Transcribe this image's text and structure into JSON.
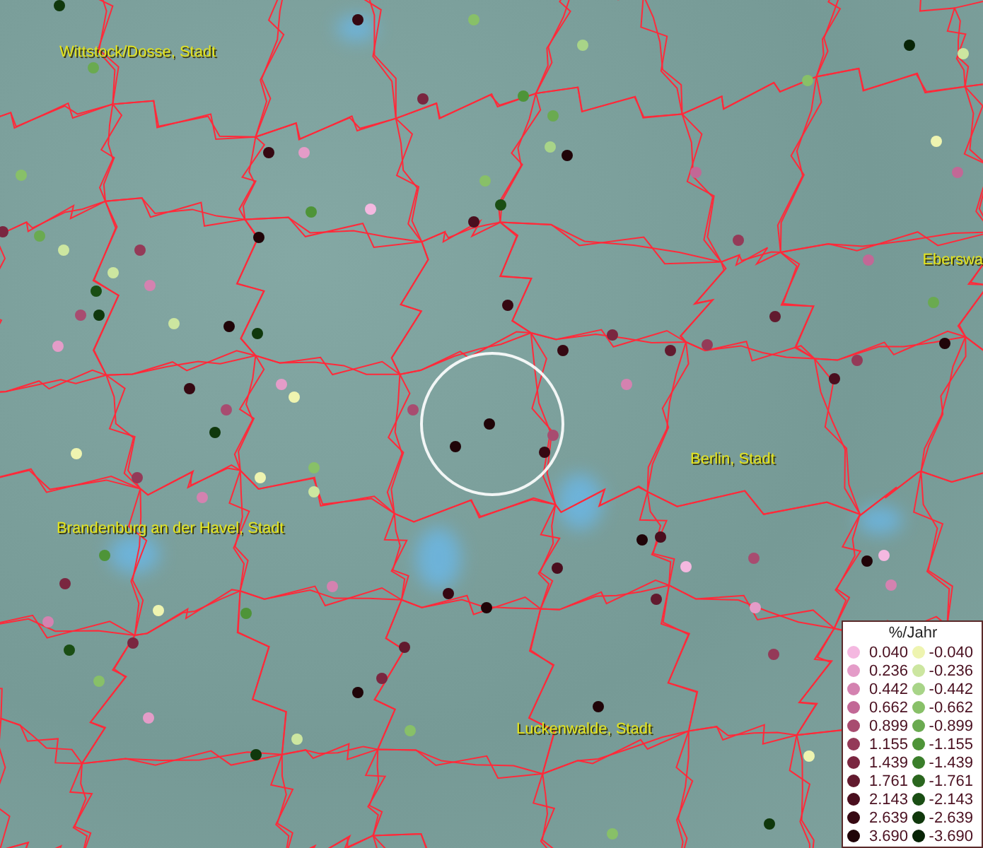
{
  "places": [
    {
      "name": "Wittstock/Dosse, Stadt"
    },
    {
      "name": "Eberswa"
    },
    {
      "name": "Berlin, Stadt"
    },
    {
      "name": "Brandenburg an der Havel, Stadt"
    },
    {
      "name": "Luckenwalde, Stadt"
    }
  ],
  "stations": [
    {
      "color": "#10380c"
    },
    {
      "color": "#360812"
    },
    {
      "color": "#88c068"
    },
    {
      "color": "#a8d488"
    },
    {
      "color": "#082406"
    },
    {
      "color": "#cce6a0"
    },
    {
      "color": "#88c068"
    },
    {
      "color": "#7a2640"
    },
    {
      "color": "#4e9438"
    },
    {
      "color": "#6aaa50"
    },
    {
      "color": "#6aaa50"
    },
    {
      "color": "#360812"
    },
    {
      "color": "#e49cc8"
    },
    {
      "color": "#a8d488"
    },
    {
      "color": "#200408"
    },
    {
      "color": "#88c068"
    },
    {
      "color": "#c26896"
    },
    {
      "color": "#c26896"
    },
    {
      "color": "#eef4b0"
    },
    {
      "color": "#88c068"
    },
    {
      "color": "#1a4e14"
    },
    {
      "color": "#4e9438"
    },
    {
      "color": "#f4b8e0"
    },
    {
      "color": "#4a0e1e"
    },
    {
      "color": "#200408"
    },
    {
      "color": "#7a2640"
    },
    {
      "color": "#6aaa50"
    },
    {
      "color": "#cce6a0"
    },
    {
      "color": "#943a58"
    },
    {
      "color": "#943a58"
    },
    {
      "color": "#c26896"
    },
    {
      "color": "#cce6a0"
    },
    {
      "color": "#d482b0"
    },
    {
      "color": "#1a4e14"
    },
    {
      "color": "#a84c70"
    },
    {
      "color": "#10380c"
    },
    {
      "color": "#6aaa50"
    },
    {
      "color": "#360812"
    },
    {
      "color": "#200408"
    },
    {
      "color": "#10380c"
    },
    {
      "color": "#cce6a0"
    },
    {
      "color": "#e49cc8"
    },
    {
      "color": "#7a2640"
    },
    {
      "color": "#621a2e"
    },
    {
      "color": "#200408"
    },
    {
      "color": "#360812"
    },
    {
      "color": "#621a2e"
    },
    {
      "color": "#943a58"
    },
    {
      "color": "#4a0e1e"
    },
    {
      "color": "#943a58"
    },
    {
      "color": "#d482b0"
    },
    {
      "color": "#360812"
    },
    {
      "color": "#eef4b0"
    },
    {
      "color": "#e49cc8"
    },
    {
      "color": "#a84c70"
    },
    {
      "color": "#a84c70"
    },
    {
      "color": "#200408"
    },
    {
      "color": "#200408"
    },
    {
      "color": "#360812"
    },
    {
      "color": "#a84c70"
    },
    {
      "color": "#10380c"
    },
    {
      "color": "#eef4b0"
    },
    {
      "color": "#eef4b0"
    },
    {
      "color": "#88c068"
    },
    {
      "color": "#cce6a0"
    },
    {
      "color": "#d482b0"
    },
    {
      "color": "#943a58"
    },
    {
      "color": "#200408"
    },
    {
      "color": "#4a0e1e"
    },
    {
      "color": "#4a0e1e"
    },
    {
      "color": "#f4b8e0"
    },
    {
      "color": "#a84c70"
    },
    {
      "color": "#200408"
    },
    {
      "color": "#f4b8e0"
    },
    {
      "color": "#d482b0"
    },
    {
      "color": "#4e9438"
    },
    {
      "color": "#7a2640"
    },
    {
      "color": "#d482b0"
    },
    {
      "color": "#360812"
    },
    {
      "color": "#200408"
    },
    {
      "color": "#621a2e"
    },
    {
      "color": "#e49cc8"
    },
    {
      "color": "#d482b0"
    },
    {
      "color": "#eef4b0"
    },
    {
      "color": "#4e9438"
    },
    {
      "color": "#7a2640"
    },
    {
      "color": "#1a4e14"
    },
    {
      "color": "#621a2e"
    },
    {
      "color": "#200408"
    },
    {
      "color": "#7a2640"
    },
    {
      "color": "#88c068"
    },
    {
      "color": "#e49cc8"
    },
    {
      "color": "#cce6a0"
    },
    {
      "color": "#10380c"
    },
    {
      "color": "#88c068"
    },
    {
      "color": "#200408"
    },
    {
      "color": "#943a58"
    },
    {
      "color": "#eef4b0"
    },
    {
      "color": "#10380c"
    },
    {
      "color": "#88c068"
    }
  ],
  "legend": {
    "title": "%/Jahr",
    "rows": [
      {
        "positive": {
          "label": "0.040",
          "color": "#f4b8e0"
        },
        "negative": {
          "label": "-0.040",
          "color": "#eef4b0"
        }
      },
      {
        "positive": {
          "label": "0.236",
          "color": "#e49cc8"
        },
        "negative": {
          "label": "-0.236",
          "color": "#cce6a0"
        }
      },
      {
        "positive": {
          "label": "0.442",
          "color": "#d482b0"
        },
        "negative": {
          "label": "-0.442",
          "color": "#a8d488"
        }
      },
      {
        "positive": {
          "label": "0.662",
          "color": "#c26896"
        },
        "negative": {
          "label": "-0.662",
          "color": "#88c068"
        }
      },
      {
        "positive": {
          "label": "0.899",
          "color": "#a84c70"
        },
        "negative": {
          "label": "-0.899",
          "color": "#6aaa50"
        }
      },
      {
        "positive": {
          "label": "1.155",
          "color": "#943a58"
        },
        "negative": {
          "label": "-1.155",
          "color": "#4e9438"
        }
      },
      {
        "positive": {
          "label": "1.439",
          "color": "#7a2640"
        },
        "negative": {
          "label": "-1.439",
          "color": "#3a7e2a"
        }
      },
      {
        "positive": {
          "label": "1.761",
          "color": "#621a2e"
        },
        "negative": {
          "label": "-1.761",
          "color": "#2a661e"
        }
      },
      {
        "positive": {
          "label": "2.143",
          "color": "#4a0e1e"
        },
        "negative": {
          "label": "-2.143",
          "color": "#1a4e14"
        }
      },
      {
        "positive": {
          "label": "2.639",
          "color": "#360812"
        },
        "negative": {
          "label": "-2.639",
          "color": "#10380c"
        }
      },
      {
        "positive": {
          "label": "3.690",
          "color": "#200408"
        },
        "negative": {
          "label": "-3.690",
          "color": "#082406"
        }
      }
    ]
  }
}
